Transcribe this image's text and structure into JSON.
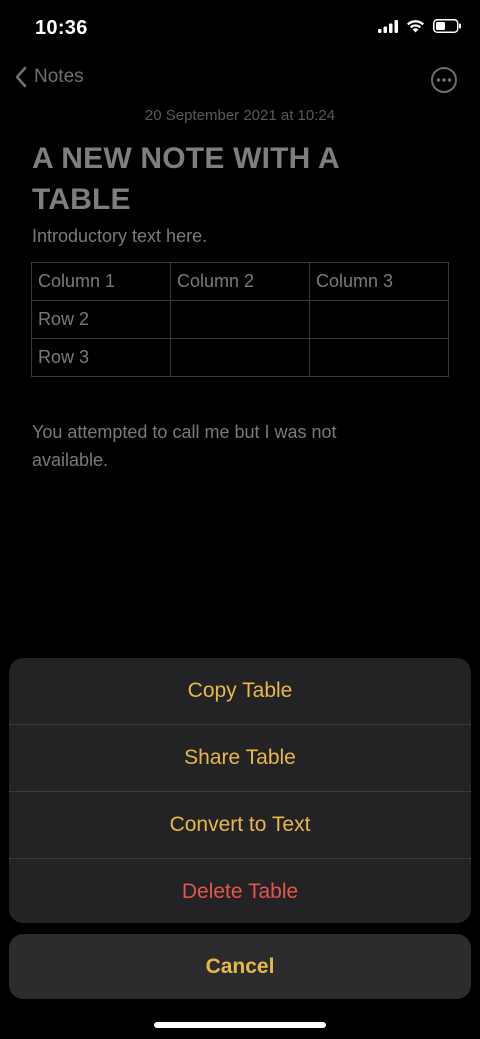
{
  "status_bar": {
    "time": "10:36",
    "icons": [
      "signal-icon",
      "wifi-icon",
      "battery-icon"
    ]
  },
  "nav": {
    "back_label": "Notes",
    "back_icon": "chevron-left-icon",
    "more_icon": "ellipsis-circle-icon"
  },
  "note": {
    "date": "20 September 2021 at 10:24",
    "title": "A NEW NOTE WITH A TABLE",
    "intro": "Introductory text here.",
    "table": [
      [
        "Column 1",
        "Column 2",
        "Column 3"
      ],
      [
        "Row 2",
        "",
        ""
      ],
      [
        "Row 3",
        "",
        ""
      ]
    ],
    "body": "You attempted to call me but I was not available."
  },
  "action_sheet": {
    "items": [
      {
        "label": "Copy Table"
      },
      {
        "label": "Share Table"
      },
      {
        "label": "Convert to Text"
      },
      {
        "label": "Delete Table"
      }
    ],
    "cancel_label": "Cancel"
  },
  "colors": {
    "accent": "#e7b84a",
    "destructive": "#e3564d",
    "sheet_background": "#232325"
  }
}
